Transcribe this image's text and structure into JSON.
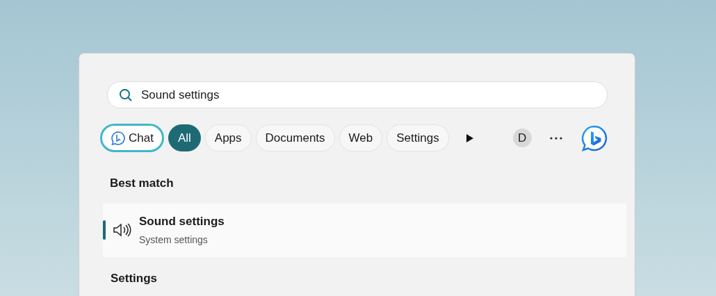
{
  "search": {
    "value": "Sound settings"
  },
  "filters": [
    {
      "kind": "chat",
      "label": "Chat",
      "selected": false
    },
    {
      "kind": "filter",
      "label": "All",
      "selected": true
    },
    {
      "kind": "filter",
      "label": "Apps",
      "selected": false
    },
    {
      "kind": "filter",
      "label": "Documents",
      "selected": false
    },
    {
      "kind": "filter",
      "label": "Web",
      "selected": false
    },
    {
      "kind": "filter",
      "label": "Settings",
      "selected": false
    }
  ],
  "account": {
    "initial": "D"
  },
  "best_match": {
    "heading": "Best match",
    "title": "Sound settings",
    "subtitle": "System settings",
    "selected": true
  },
  "settings_heading": "Settings"
}
